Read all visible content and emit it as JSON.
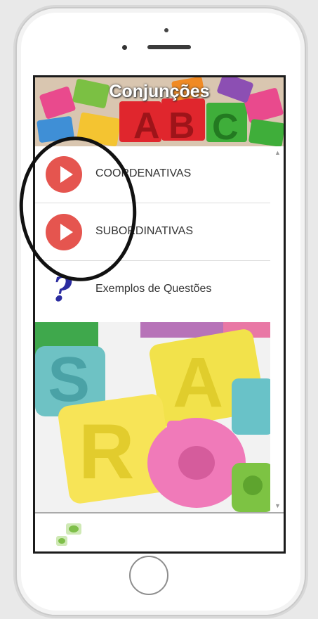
{
  "app": {
    "title": "Conjunções"
  },
  "menu": {
    "items": [
      {
        "label": "COORDENATIVAS",
        "icon": "play-icon"
      },
      {
        "label": "SUBORDINATIVAS",
        "icon": "play-icon"
      },
      {
        "label": "Exemplos de Questões",
        "icon": "question-mark-icon"
      }
    ]
  },
  "colors": {
    "play_button": "#e5554f",
    "question_mark": "#2b2ca0",
    "annotation": "#111111"
  },
  "icons": {
    "scroll_up": "▲",
    "scroll_down": "▼",
    "question": "?"
  }
}
